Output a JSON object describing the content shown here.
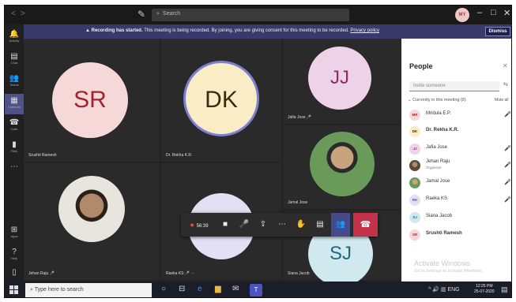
{
  "titlebar": {
    "nav_back": "<",
    "nav_forward": ">",
    "compose_glyph": "✎",
    "search_placeholder": "Search",
    "me_initials": "MY",
    "minimize": "–",
    "maximize": "□",
    "close": "✕"
  },
  "rail": {
    "items": [
      {
        "label": "Activity",
        "icon": "bell-icon",
        "glyph": "🔔"
      },
      {
        "label": "Chat",
        "icon": "chat-icon",
        "glyph": "▤"
      },
      {
        "label": "Teams",
        "icon": "teams-icon",
        "glyph": "👥"
      },
      {
        "label": "Calendar",
        "icon": "calendar-icon",
        "glyph": "▦"
      },
      {
        "label": "Calls",
        "icon": "phone-icon",
        "glyph": "☎"
      },
      {
        "label": "Files",
        "icon": "file-icon",
        "glyph": "▮"
      },
      {
        "label": "More",
        "icon": "more-icon",
        "glyph": "⋯"
      },
      {
        "label": "Apps",
        "icon": "apps-icon",
        "glyph": "⊞"
      },
      {
        "label": "Help",
        "icon": "help-icon",
        "glyph": "?"
      },
      {
        "label": "",
        "icon": "device-icon",
        "glyph": "▯"
      }
    ]
  },
  "banner": {
    "bold_text": "Recording has started.",
    "text": " This meeting is being recorded. By joining, you are giving consent for this meeting to be recorded.",
    "link": "Privacy policy",
    "dismiss": "Dismiss",
    "warning_glyph": "▲"
  },
  "tiles": [
    {
      "initials": "SR",
      "name": "Srushti Ramesh",
      "bg": "#f6d8d8",
      "fg": "#a0262e"
    },
    {
      "initials": "DK",
      "name": "Dr. Rekha K.R.",
      "bg": "#faecc5",
      "fg": "#3a2a10"
    },
    {
      "initials": "JJ",
      "name": "Jafia Jose",
      "bg": "#eed3e8",
      "fg": "#8a2a70",
      "mic": "🎤"
    },
    {
      "initials": "",
      "name": "Jamal Jose",
      "photo": true
    },
    {
      "initials": "",
      "name": "Jehan Raju",
      "photo": true,
      "mic": "🎤"
    },
    {
      "initials": "",
      "name": "Raeka KS",
      "bg": "#e3e0f3",
      "mic": "🎤",
      "more": "⋯"
    },
    {
      "initials": "SJ",
      "name": "Siana Jacob",
      "bg": "#cfe9ef",
      "fg": "#206a7a"
    }
  ],
  "controls": {
    "record_glyph": "●",
    "timer": "56:39",
    "camera_glyph": "■",
    "mic_glyph": "🎤",
    "share_glyph": "⇪",
    "more_glyph": "⋯",
    "hand_glyph": "✋",
    "chat_glyph": "▤",
    "people_glyph": "👥",
    "hangup_glyph": "☎"
  },
  "people": {
    "title": "People",
    "close": "✕",
    "invite_placeholder": "Invite someone",
    "invite_icon": "⇆",
    "section": "Currently in this meeting (8)",
    "mute_all": "Mute all",
    "mic_glyph": "🎤",
    "participants": [
      {
        "initials": "MR",
        "name": "Mridula E.P.",
        "bg": "#f6d8d8",
        "fg": "#a0262e",
        "mic": true
      },
      {
        "initials": "DK",
        "name": "Dr. Rekha K.R.",
        "bg": "#faecc5",
        "fg": "#3a2a10",
        "bold": true
      },
      {
        "initials": "JJ",
        "name": "Jafia Jose",
        "bg": "#eed3e8",
        "fg": "#8a2a70",
        "mic": true
      },
      {
        "initials": "",
        "name": "Jehan Raju",
        "subtitle": "Organizer",
        "bg": "#5a4a3a",
        "fg": "#fff",
        "mic": true
      },
      {
        "initials": "",
        "name": "Jamal Jose",
        "bg": "#6a7a4a",
        "fg": "#fff",
        "mic": true
      },
      {
        "initials": "RK",
        "name": "Raeka KS",
        "bg": "#e3e0f3",
        "fg": "#4b53bc",
        "mic": true
      },
      {
        "initials": "SJ",
        "name": "Siana Jacob",
        "bg": "#cfe9ef",
        "fg": "#206a7a"
      },
      {
        "initials": "SR",
        "name": "Srushti Ramesh",
        "bg": "#f6d8d8",
        "fg": "#a0262e",
        "bold": true
      }
    ],
    "watermark_title": "Activate Windows",
    "watermark_sub": "Go to Settings to activate Windows."
  },
  "taskbar": {
    "search_placeholder": "Type here to search",
    "search_glyph": "⌕",
    "apps": [
      "○",
      "⊟",
      "e",
      "▆",
      "✉"
    ],
    "teams_glyph": "T",
    "tray": "^ 🔊 ▥ ENG",
    "time": "12:25 PM",
    "date": "25-07-2020",
    "notif_glyph": "▤"
  },
  "colors": {
    "banner_bg": "#373a6a",
    "hangup": "#c4314b",
    "brand": "#4b53bc"
  }
}
